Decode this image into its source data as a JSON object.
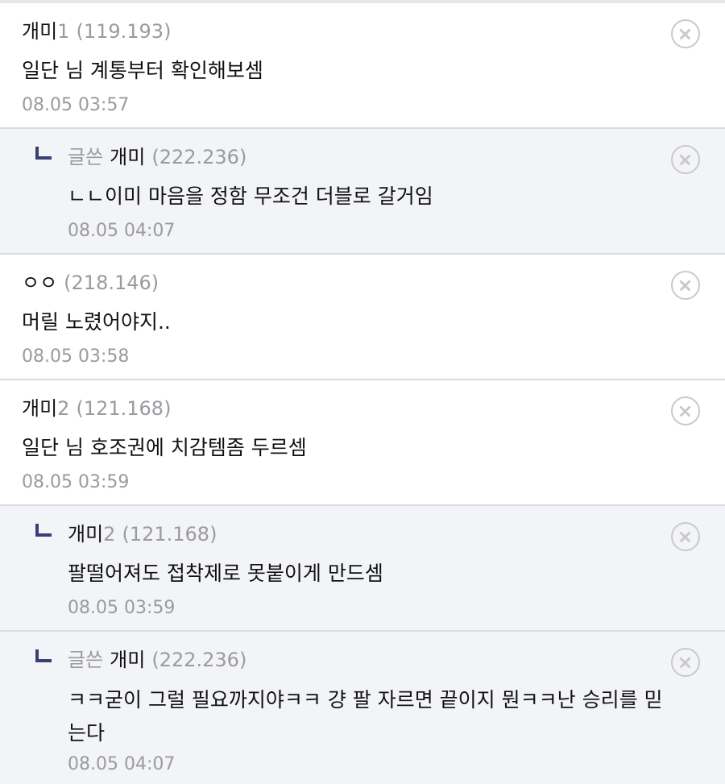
{
  "comments": [
    {
      "op_badge": "",
      "nick": "개미",
      "nick_num": "1",
      "ip": "(119.193)",
      "text": "일단 님 계통부터 확인해보셈",
      "date": "08.05 03:57"
    },
    {
      "op_badge": "글쓴",
      "nick": "개미",
      "nick_num": "",
      "ip": "(222.236)",
      "text": "ㄴㄴ이미 마음을 정함 무조건 더블로 갈거임",
      "date": "08.05 04:07"
    },
    {
      "op_badge": "",
      "nick": "ㅇㅇ",
      "nick_num": "",
      "ip": "(218.146)",
      "text": "머릴 노렸어야지..",
      "date": "08.05 03:58"
    },
    {
      "op_badge": "",
      "nick": "개미",
      "nick_num": "2",
      "ip": "(121.168)",
      "text": "일단 님 호조권에 치감템좀 두르셈",
      "date": "08.05 03:59"
    },
    {
      "op_badge": "",
      "nick": "개미",
      "nick_num": "2",
      "ip": "(121.168)",
      "text": "팔떨어져도 접착제로 못붙이게 만드셈",
      "date": "08.05 03:59"
    },
    {
      "op_badge": "글쓴",
      "nick": "개미",
      "nick_num": "",
      "ip": "(222.236)",
      "text": "ㅋㅋ굳이 그럴 필요까지야ㅋㅋ 걍 팔 자르면 끝이지 뭔ㅋㅋ난 승리를 믿는다",
      "date": "08.05 04:07"
    }
  ],
  "colors": {
    "reply_arrow": "#3a3f72",
    "meta_gray": "#9a9aa0",
    "reply_bg": "#f3f4f7",
    "divider": "#dcdce0"
  },
  "icons": {
    "delete": "close-circle-icon",
    "reply": "reply-arrow-icon"
  }
}
